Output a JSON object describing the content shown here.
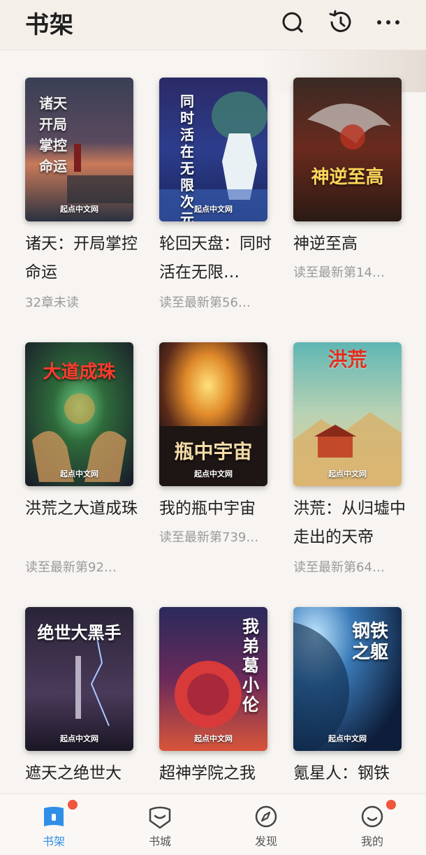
{
  "header": {
    "title": "书架",
    "icons": [
      "search-icon",
      "history-icon",
      "more-icon"
    ]
  },
  "books": [
    {
      "title": "诸天：开局掌控命运",
      "status": "32章未读",
      "cover_text": "诸天 开局掌控命运",
      "cover_brand": "起点中文网"
    },
    {
      "title": "轮回天盘：同时活在无限…",
      "status": "读至最新第56…",
      "cover_text": "同时活在无限次元",
      "cover_brand": "起点中文网"
    },
    {
      "title": "神逆至高",
      "status": "读至最新第14…",
      "cover_text": "神逆至高",
      "cover_brand": ""
    },
    {
      "title": "洪荒之大道成珠",
      "status": "读至最新第92…",
      "cover_text": "大道成珠",
      "cover_brand": "起点中文网"
    },
    {
      "title": "我的瓶中宇宙",
      "status": "读至最新第739…",
      "cover_text": "瓶中宇宙",
      "cover_brand": "起点中文网"
    },
    {
      "title": "洪荒：从归墟中走出的天帝",
      "status": "读至最新第64…",
      "cover_text": "洪荒",
      "cover_brand": "起点中文网"
    },
    {
      "title": "遮天之绝世大",
      "status": "",
      "cover_text": "绝世大黑手",
      "cover_brand": "起点中文网"
    },
    {
      "title": "超神学院之我",
      "status": "",
      "cover_text": "我弟葛小伦",
      "cover_brand": "起点中文网"
    },
    {
      "title": "氪星人：钢铁",
      "status": "",
      "cover_text": "钢铁之躯",
      "cover_brand": "起点中文网"
    }
  ],
  "bottom_nav": [
    {
      "label": "书架",
      "icon": "bookshelf-icon",
      "active": true,
      "badge": true
    },
    {
      "label": "书城",
      "icon": "bookstore-icon",
      "active": false,
      "badge": false
    },
    {
      "label": "发现",
      "icon": "compass-icon",
      "active": false,
      "badge": false
    },
    {
      "label": "我的",
      "icon": "profile-icon",
      "active": false,
      "badge": true
    }
  ],
  "colors": {
    "accent": "#2f8ee8",
    "badge": "#f0553e",
    "status_text": "#9a9a9a"
  }
}
